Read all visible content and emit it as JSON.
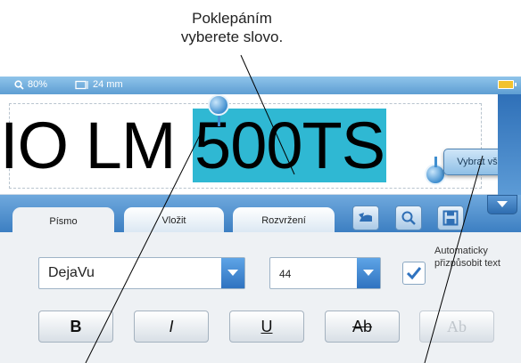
{
  "annotation": {
    "top_line1": "Poklepáním",
    "top_line2": "vyberete slovo."
  },
  "status": {
    "zoom": "80%",
    "width": "24 mm"
  },
  "editor": {
    "text_before": "IO LM ",
    "text_selected": "500TS",
    "select_all_label": "Vybrat vše"
  },
  "tabs": [
    {
      "label": "Písmo",
      "active": true
    },
    {
      "label": "Vložit",
      "active": false
    },
    {
      "label": "Rozvržení",
      "active": false
    }
  ],
  "font": {
    "family": "DejaVu",
    "size": "44",
    "auto_fit_checked": true,
    "auto_fit_label": "Automaticky přizpůsobit text"
  },
  "format_buttons": {
    "bold": "B",
    "italic": "I",
    "underline": "U",
    "strike": "Ab",
    "outline": "Ab"
  },
  "colors": {
    "selection": "#2fb8d3",
    "accent": "#3c7fc2"
  },
  "icons": [
    "search-icon",
    "tape-width-icon",
    "battery-icon",
    "undo-icon",
    "zoom-icon",
    "save-icon",
    "chevron-down-icon",
    "checkmark-icon"
  ]
}
